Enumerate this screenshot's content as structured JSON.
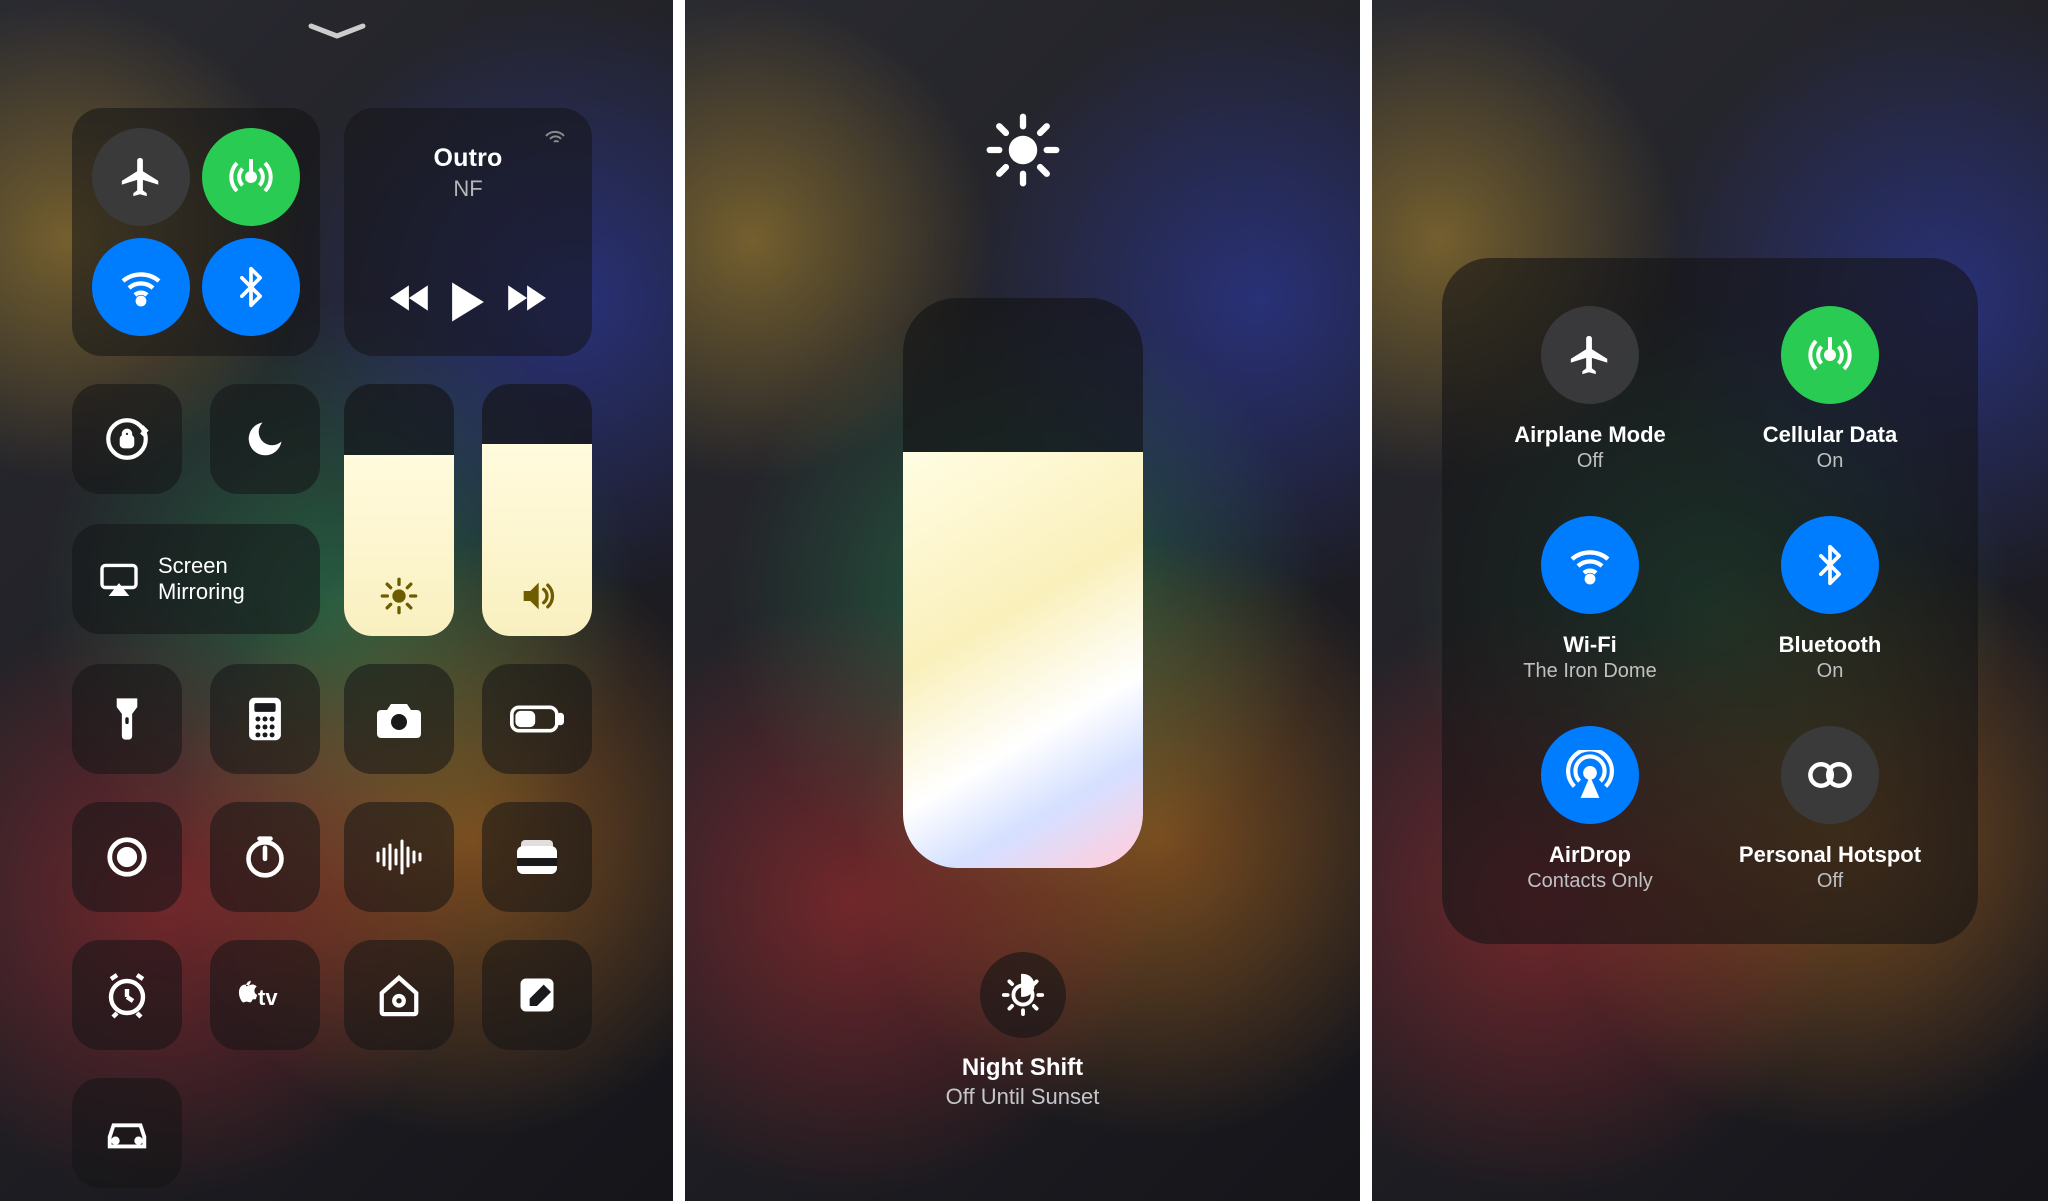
{
  "panel1": {
    "media": {
      "title": "Outro",
      "artist": "NF"
    },
    "mirror_label": "Screen\nMirroring",
    "brightness_percent": 72,
    "volume_percent": 76
  },
  "panel2": {
    "brightness_percent": 73,
    "night_shift": {
      "title": "Night Shift",
      "subtitle": "Off Until Sunset"
    }
  },
  "panel3": {
    "items": [
      {
        "label": "Airplane Mode",
        "sub": "Off"
      },
      {
        "label": "Cellular Data",
        "sub": "On"
      },
      {
        "label": "Wi-Fi",
        "sub": "The Iron Dome"
      },
      {
        "label": "Bluetooth",
        "sub": "On"
      },
      {
        "label": "AirDrop",
        "sub": "Contacts Only"
      },
      {
        "label": "Personal Hotspot",
        "sub": "Off"
      }
    ]
  }
}
